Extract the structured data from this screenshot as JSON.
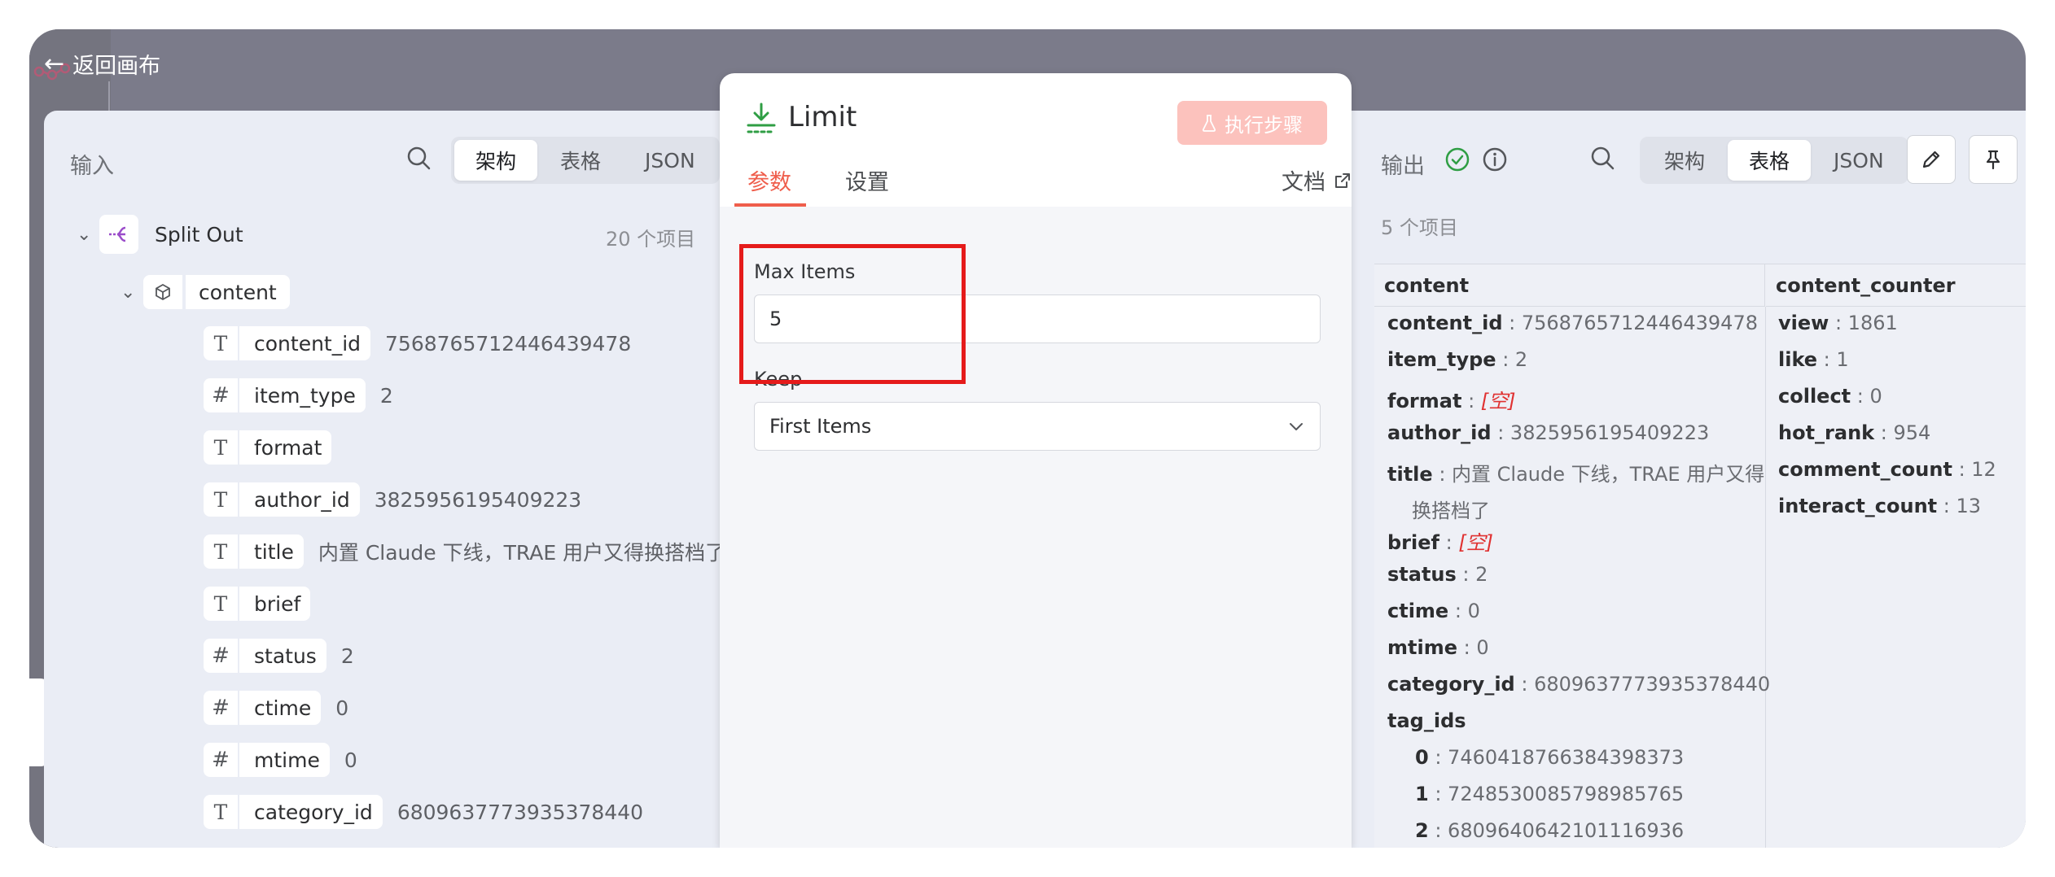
{
  "back_label": "返回画布",
  "input": {
    "title": "输入",
    "views": [
      "架构",
      "表格",
      "JSON"
    ],
    "active_view": "架构",
    "node": {
      "name": "Split Out",
      "count": "20 个项目"
    },
    "object_name": "content",
    "fields": [
      {
        "type": "T",
        "name": "content_id",
        "value": "7568765712446439478"
      },
      {
        "type": "#",
        "name": "item_type",
        "value": "2"
      },
      {
        "type": "T",
        "name": "format",
        "value": ""
      },
      {
        "type": "T",
        "name": "author_id",
        "value": "3825956195409223"
      },
      {
        "type": "T",
        "name": "title",
        "value": "内置 Claude 下线，TRAE 用户又得换搭档了"
      },
      {
        "type": "T",
        "name": "brief",
        "value": ""
      },
      {
        "type": "#",
        "name": "status",
        "value": "2"
      },
      {
        "type": "#",
        "name": "ctime",
        "value": "0"
      },
      {
        "type": "#",
        "name": "mtime",
        "value": "0"
      },
      {
        "type": "T",
        "name": "category_id",
        "value": "6809637773935378440"
      }
    ]
  },
  "modal": {
    "title": "Limit",
    "run_label": "执行步骤",
    "tabs": [
      "参数",
      "设置"
    ],
    "active_tab": "参数",
    "docs_label": "文档",
    "max_items_label": "Max Items",
    "max_items_value": "5",
    "keep_label": "Keep",
    "keep_value": "First Items"
  },
  "output": {
    "title": "输出",
    "views": [
      "架构",
      "表格",
      "JSON"
    ],
    "active_view": "表格",
    "count": "5 个项目",
    "columns": [
      "content",
      "content_counter"
    ],
    "content_lines": [
      {
        "k": "content_id",
        "v": "7568765712446439478"
      },
      {
        "k": "item_type",
        "v": "2"
      },
      {
        "k": "format",
        "v": "[空]",
        "empty": true
      },
      {
        "k": "author_id",
        "v": "3825956195409223"
      },
      {
        "k": "title",
        "v": "内置 Claude 下线，TRAE 用户又得"
      },
      {
        "k": "",
        "v": "换搭档了",
        "cont": true
      },
      {
        "k": "brief",
        "v": "[空]",
        "empty": true
      },
      {
        "k": "status",
        "v": "2"
      },
      {
        "k": "ctime",
        "v": "0"
      },
      {
        "k": "mtime",
        "v": "0"
      },
      {
        "k": "category_id",
        "v": "6809637773935378440"
      },
      {
        "k": "tag_ids",
        "v": "",
        "header": true
      },
      {
        "k": "0",
        "v": "7460418766384398373",
        "sub": true
      },
      {
        "k": "1",
        "v": "7248530085798985765",
        "sub": true
      },
      {
        "k": "2",
        "v": "6809640642101116936",
        "sub": true
      }
    ],
    "counter_lines": [
      {
        "k": "view",
        "v": "1861"
      },
      {
        "k": "like",
        "v": "1"
      },
      {
        "k": "collect",
        "v": "0"
      },
      {
        "k": "hot_rank",
        "v": "954"
      },
      {
        "k": "comment_count",
        "v": "12"
      },
      {
        "k": "interact_count",
        "v": "13"
      }
    ]
  },
  "colors": {
    "accent": "#ef5e4c",
    "success": "#2f9e44",
    "highlight": "#e51b1b",
    "empty": "#e03131"
  }
}
